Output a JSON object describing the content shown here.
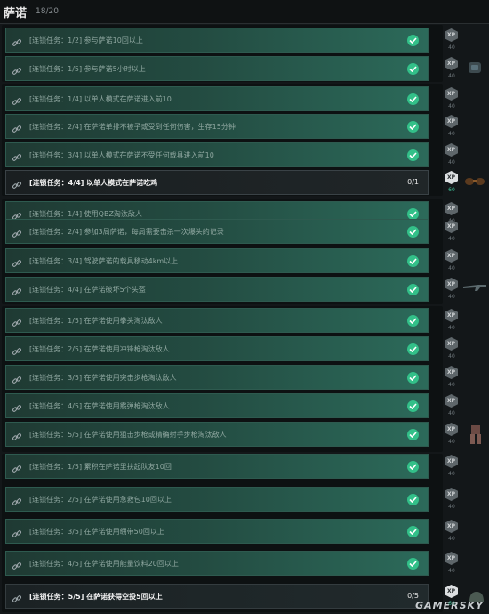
{
  "header": {
    "title": "萨诺",
    "count": "18/20"
  },
  "tasks": [
    {
      "text": "[连锁任务：1/2] 参与萨诺10回以上",
      "status": "done",
      "points": "40"
    },
    {
      "text": "[连锁任务：1/5] 参与萨诺5小时以上",
      "status": "done",
      "points": "40"
    },
    {
      "text": "[连锁任务：1/4] 以单人模式在萨诺进入前10",
      "status": "done",
      "points": "40"
    },
    {
      "text": "[连锁任务：2/4] 在萨诺单排不被子或受到任何伤害，生存15分钟",
      "status": "done",
      "points": "40"
    },
    {
      "text": "[连锁任务：3/4] 以单人模式在萨诺不受任何载具进入前10",
      "status": "done",
      "points": "40"
    },
    {
      "text": "[连锁任务：4/4] 以单人模式在萨诺吃鸡",
      "status": "active",
      "progress": "0/1",
      "points": "60"
    },
    {
      "text": "[连锁任务：1/4] 使用QBZ淘汰敌人",
      "status": "done",
      "points": "40"
    },
    {
      "text": "[连锁任务：2/4] 参加3局萨诺，每局需要击杀一次爆头的记录",
      "status": "done",
      "points": "40"
    },
    {
      "text": "[连锁任务：3/4] 驾驶萨诺的载具移动4km以上",
      "status": "done",
      "points": "40"
    },
    {
      "text": "[连锁任务：4/4] 在萨诺破坏5个头盔",
      "status": "done",
      "points": "40"
    },
    {
      "text": "[连锁任务：1/5] 在萨诺使用拳头淘汰敌人",
      "status": "done",
      "points": "40"
    },
    {
      "text": "[连锁任务：2/5] 在萨诺使用冲锋枪淘汰敌人",
      "status": "done",
      "points": "40"
    },
    {
      "text": "[连锁任务：3/5] 在萨诺使用突击步枪淘汰敌人",
      "status": "done",
      "points": "40"
    },
    {
      "text": "[连锁任务：4/5] 在萨诺使用霰弹枪淘汰敌人",
      "status": "done",
      "points": "40"
    },
    {
      "text": "[连锁任务：5/5] 在萨诺使用狙击步枪或精确射手步枪淘汰敌人",
      "status": "done",
      "points": "40"
    },
    {
      "text": "[连锁任务：1/5] 累积在萨诺里扶起队友10回",
      "status": "done",
      "points": "40"
    },
    {
      "text": "[连锁任务：2/5] 在萨诺使用急救包10回以上",
      "status": "done",
      "points": "40"
    },
    {
      "text": "[连锁任务：3/5] 在萨诺使用绷带50回以上",
      "status": "done",
      "points": "40"
    },
    {
      "text": "[连锁任务：4/5] 在萨诺使用能量饮料20回以上",
      "status": "done",
      "points": "40"
    },
    {
      "text": "[连锁任务：5/5] 在萨诺获得空投5回以上",
      "status": "pending",
      "progress": "0/5",
      "points": "60"
    }
  ],
  "badge_text": "XP",
  "watermark": "GAMERSKY",
  "colors": {
    "check": "#33c089",
    "done_row": "#2c6a5a",
    "accent": "#3fc39a"
  }
}
